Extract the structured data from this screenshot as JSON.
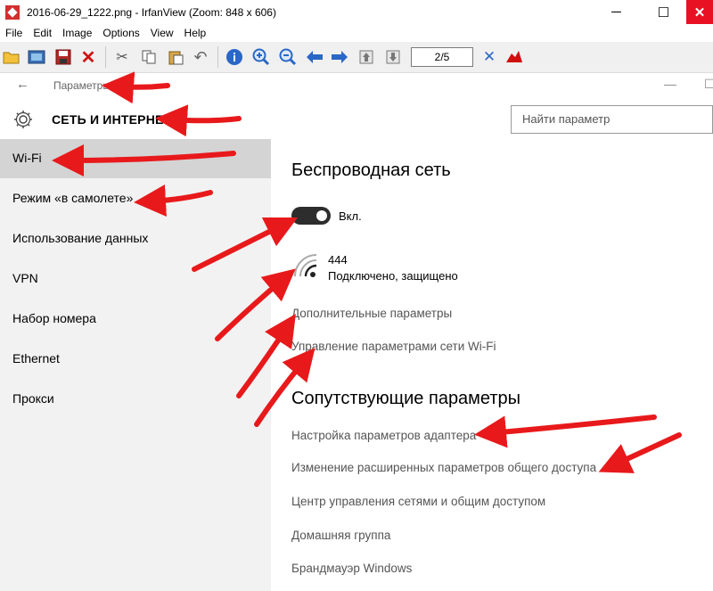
{
  "window": {
    "title": "2016-06-29_1222.png - IrfanView (Zoom: 848 x 606)",
    "minimize": "─",
    "maximize": "☐",
    "close": "✕"
  },
  "menu": [
    "File",
    "Edit",
    "Image",
    "Options",
    "View",
    "Help"
  ],
  "toolbar": {
    "page_indicator": "2/5"
  },
  "settings": {
    "app_title": "Параметры",
    "category_title": "СЕТЬ И ИНТЕРНЕТ",
    "search_placeholder": "Найти параметр",
    "nav": [
      {
        "label": "Wi-Fi",
        "active": true
      },
      {
        "label": "Режим «в самолете»",
        "active": false
      },
      {
        "label": "Использование данных",
        "active": false
      },
      {
        "label": "VPN",
        "active": false
      },
      {
        "label": "Набор номера",
        "active": false
      },
      {
        "label": "Ethernet",
        "active": false
      },
      {
        "label": "Прокси",
        "active": false
      }
    ],
    "wifi_heading": "Беспроводная сеть",
    "toggle_label": "Вкл.",
    "network_name": "444",
    "network_status": "Подключено, защищено",
    "wifi_links": [
      "Дополнительные параметры",
      "Управление параметрами сети Wi-Fi"
    ],
    "related_heading": "Сопутствующие параметры",
    "related_links": [
      "Настройка параметров адаптера",
      "Изменение расширенных параметров общего доступа",
      "Центр управления сетями и общим доступом",
      "Домашняя группа",
      "Брандмауэр Windows"
    ]
  },
  "colors": {
    "arrow": "#e8191b",
    "sidebar_bg": "#f2f2f2",
    "active_item": "#d4d4d4",
    "toggle_on": "#2d2d2d",
    "link": "#555555"
  }
}
